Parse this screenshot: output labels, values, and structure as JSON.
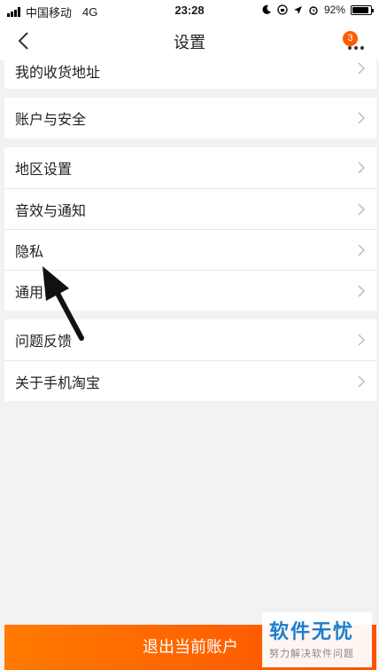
{
  "status_bar": {
    "carrier": "中国移动",
    "network": "4G",
    "time": "23:28",
    "battery": "92%",
    "battery_level": 0.92
  },
  "nav": {
    "title": "设置",
    "badge_count": "3"
  },
  "settings": {
    "group1": [
      "我的收货地址"
    ],
    "group2": [
      "账户与安全"
    ],
    "group3": [
      "地区设置",
      "音效与通知",
      "隐私",
      "通用"
    ],
    "group4": [
      "问题反馈",
      "关于手机淘宝"
    ]
  },
  "footer": {
    "logout_label": "退出当前账户"
  },
  "watermark": {
    "title": "软件无忧",
    "subtitle": "努力解决软件问题"
  },
  "colors": {
    "accent": "#ff5a00",
    "watermark_blue": "#1a7fd0"
  }
}
